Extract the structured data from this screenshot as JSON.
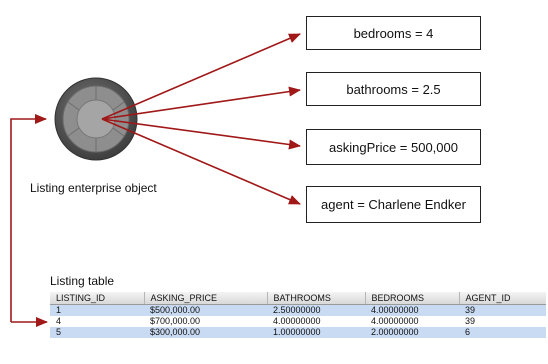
{
  "object": {
    "caption": "Listing enterprise object",
    "attributes": [
      "bedrooms = 4",
      "bathrooms = 2.5",
      "askingPrice = 500,000",
      "agent = Charlene Endker"
    ]
  },
  "table": {
    "title": "Listing table",
    "columns": [
      "LISTING_ID",
      "ASKING_PRICE",
      "BATHROOMS",
      "BEDROOMS",
      "AGENT_ID"
    ],
    "rows": [
      [
        "1",
        "$500,000.00",
        "2.50000000",
        "4.00000000",
        "39"
      ],
      [
        "4",
        "$700,000.00",
        "4.00000000",
        "4.00000000",
        "39"
      ],
      [
        "5",
        "$300,000.00",
        "1.00000000",
        "2.00000000",
        "6"
      ]
    ]
  },
  "colors": {
    "arrow": "#a01818",
    "row_highlight": "#c9dbf3",
    "object_outer": "#555555",
    "object_inner": "#a5a5a5"
  }
}
